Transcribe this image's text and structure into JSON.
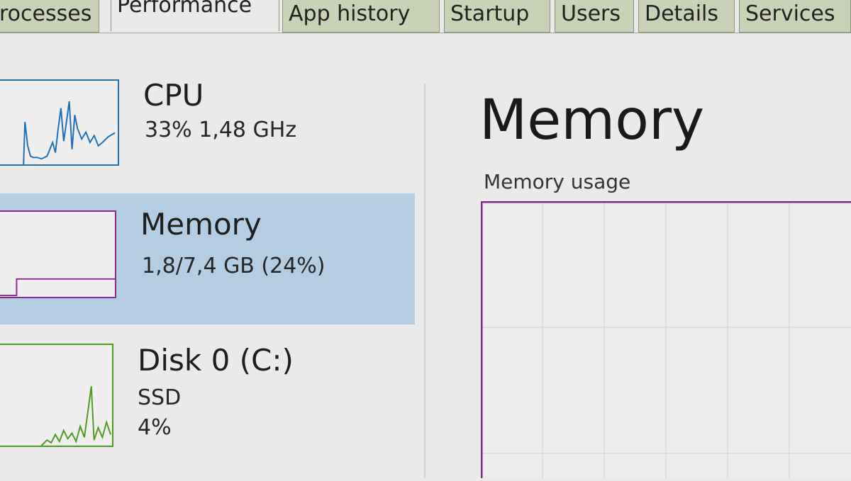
{
  "tabs": [
    {
      "label": "rocesses"
    },
    {
      "label": "Performance"
    },
    {
      "label": "App history"
    },
    {
      "label": "Startup"
    },
    {
      "label": "Users"
    },
    {
      "label": "Details"
    },
    {
      "label": "Services"
    }
  ],
  "active_tab": "Performance",
  "sidebar": {
    "items": [
      {
        "title": "CPU",
        "line1": "33% 1,48 GHz",
        "line2": "",
        "color": "#1c6fb8"
      },
      {
        "title": "Memory",
        "line1": "1,8/7,4 GB (24%)",
        "line2": "",
        "color": "#8b2a8e",
        "level": 0.24
      },
      {
        "title": "Disk 0 (C:)",
        "line1": "SSD",
        "line2": "4%",
        "color": "#4d9a1e"
      }
    ]
  },
  "main": {
    "title": "Memory",
    "subtitle": "Memory usage"
  },
  "colors": {
    "selected_bg": "#b5cde3",
    "memory_border": "#7e2d86",
    "cpu_line": "#1c6fb8",
    "disk_line": "#4d9a1e"
  }
}
